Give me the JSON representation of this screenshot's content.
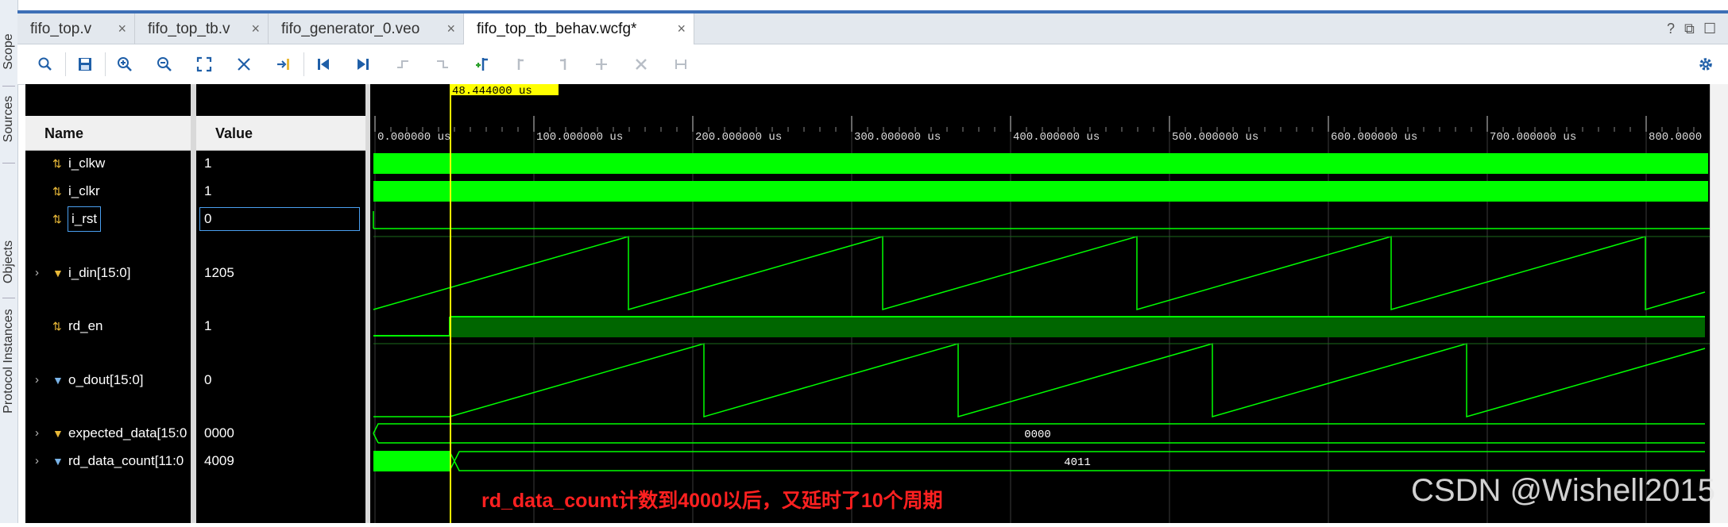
{
  "side_tabs": [
    "Scope",
    "Sources",
    "Objects",
    "Protocol Instances"
  ],
  "tabs": [
    {
      "label": "fifo_top.v",
      "close": "×",
      "active": false
    },
    {
      "label": "fifo_top_tb.v",
      "close": "×",
      "active": false
    },
    {
      "label": "fifo_generator_0.veo",
      "close": "×",
      "active": false
    },
    {
      "label": "fifo_top_tb_behav.wcfg*",
      "close": "×",
      "active": true
    }
  ],
  "window_controls": {
    "help": "?",
    "restore": "⧉",
    "maximize": "☐"
  },
  "toolbar_icons": [
    "search-icon",
    "save-icon",
    "zoom-in-icon",
    "zoom-out-icon",
    "zoom-fit-icon",
    "cursor-to-zero-icon",
    "go-to-cursor-icon",
    "go-to-time-zero-icon",
    "go-to-last-time-icon",
    "previous-transition-icon",
    "next-transition-icon",
    "add-marker-icon",
    "previous-marker-icon",
    "next-marker-icon",
    "swap-cursors-icon",
    "delete-markers-icon",
    "snap-icon",
    "settings-icon"
  ],
  "columns": {
    "name": "Name",
    "value": "Value"
  },
  "cursor_time": "48.444000 us",
  "timeline": {
    "unit": "us",
    "ticks": [
      "0.000000 us",
      "100.000000 us",
      "200.000000 us",
      "300.000000 us",
      "400.000000 us",
      "500.000000 us",
      "600.000000 us",
      "700.000000 us",
      "800.0000"
    ]
  },
  "signals": [
    {
      "name": "i_clkw",
      "value": "1",
      "expandable": false,
      "kind": "bit",
      "icon_color": "#e8b838"
    },
    {
      "name": "i_clkr",
      "value": "1",
      "expandable": false,
      "kind": "bit",
      "icon_color": "#e8b838"
    },
    {
      "name": "i_rst",
      "value": "0",
      "expandable": false,
      "kind": "bit",
      "icon_color": "#e8b838",
      "selected": true
    },
    {
      "name": "i_din[15:0]",
      "value": "1205",
      "expandable": true,
      "kind": "bus",
      "icon_color": "#e8b838"
    },
    {
      "name": "rd_en",
      "value": "1",
      "expandable": false,
      "kind": "bit",
      "icon_color": "#e8b838"
    },
    {
      "name": "o_dout[15:0]",
      "value": "0",
      "expandable": true,
      "kind": "bus",
      "icon_color": "#7ab4e8"
    },
    {
      "name": "expected_data[15:0",
      "value": "0000",
      "expandable": true,
      "kind": "bus",
      "icon_color": "#e8b838"
    },
    {
      "name": "rd_data_count[11:0",
      "value": "4009",
      "expandable": true,
      "kind": "bus",
      "icon_color": "#7ab4e8"
    }
  ],
  "bus_labels": {
    "expected_data": "0000",
    "rd_data_count": "4011"
  },
  "colors": {
    "wave": "#00ff00",
    "wave_dim": "#006600",
    "cursor": "#ffff00",
    "grid": "#3a3a3a",
    "annotation": "#ff2020"
  },
  "annotation": "rd_data_count计数到4000以后，又延时了10个周期",
  "watermark": "CSDN @Wishell2015"
}
